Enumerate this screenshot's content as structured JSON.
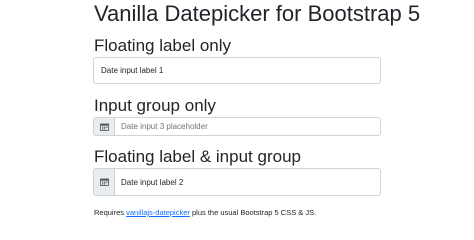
{
  "page": {
    "title": "Vanilla Datepicker for Bootstrap 5"
  },
  "sections": {
    "floating": {
      "heading": "Floating label only",
      "input_label": "Date input label 1"
    },
    "input_group": {
      "heading": "Input group only",
      "placeholder": "Date input 3 placeholder",
      "icon": "calendar-icon"
    },
    "floating_group": {
      "heading": "Floating label & input group",
      "input_label": "Date input label 2",
      "icon": "calendar-icon"
    }
  },
  "footer": {
    "prefix": "Requires",
    "link_text": "vanillajs-datepicker",
    "suffix": "plus the usual Bootstrap 5 CSS & JS."
  },
  "colors": {
    "link": "#0d6efd",
    "border": "#ced4da",
    "addon_bg": "#e9ecef",
    "text": "#212529",
    "placeholder": "#6c757d"
  }
}
